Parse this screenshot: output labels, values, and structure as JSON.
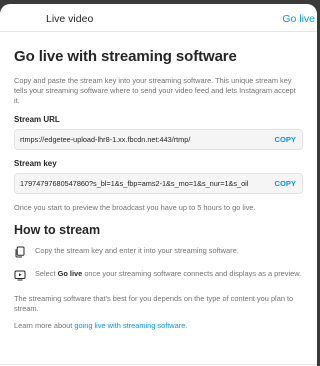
{
  "header": {
    "title": "Live video",
    "action_label": "Go live"
  },
  "main": {
    "title": "Go live with streaming software",
    "intro": "Copy and paste the stream key into your streaming software. This unique stream key tells your streaming software where to send your video feed and lets Instagram accept it.",
    "stream_url": {
      "label": "Stream URL",
      "value": "rtmps://edgetee-upload-lhr8-1.xx.fbcdn.net:443/rtmp/",
      "copy_label": "COPY"
    },
    "stream_key": {
      "label": "Stream key",
      "value": "17974797680547860?s_bl=1&s_fbp=ams2-1&s_mo=1&s_nur=1&s_oil",
      "copy_label": "COPY"
    },
    "preview_note": "Once you start to preview the broadcast you have up to 5 hours to go live."
  },
  "how_to": {
    "title": "How to stream",
    "steps": [
      {
        "icon": "document-copy-icon",
        "text": "Copy the stream key and enter it into your streaming software."
      },
      {
        "icon": "live-video-icon",
        "prefix": "Select ",
        "bold": "Go live",
        "text": " once your streaming software connects and displays as a preview."
      }
    ],
    "paragraph": "The streaming software that's best for you depends on the type of content you plan to stream.",
    "learn_prefix": "Learn more about ",
    "learn_link": "going live with streaming software",
    "learn_suffix": "."
  },
  "colors": {
    "accent": "#0095f6",
    "text": "#262626",
    "secondary_text": "#737373"
  }
}
